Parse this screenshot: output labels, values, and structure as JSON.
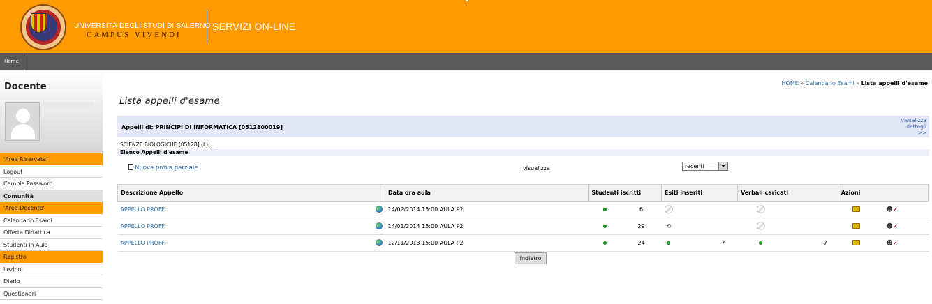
{
  "header": {
    "university_name": "UNIVERSITÀ DEGLI STUDI DI SALERNO",
    "motto": "CAMPUS VIVENDI",
    "service": "SERVIZI ON-LINE"
  },
  "navbar": {
    "home": "Home"
  },
  "sidebar": {
    "role": "Docente",
    "menu": [
      {
        "label": "'Area Riservata'",
        "kind": "header"
      },
      {
        "label": "Logout",
        "kind": "item"
      },
      {
        "label": "Cambia Password",
        "kind": "item"
      },
      {
        "label": "Comunità",
        "kind": "section"
      },
      {
        "label": "'Area Docente'",
        "kind": "header"
      },
      {
        "label": "Calendario Esami",
        "kind": "item"
      },
      {
        "label": "Offerta Didattica",
        "kind": "item"
      },
      {
        "label": "Studenti in Aula",
        "kind": "item"
      },
      {
        "label": "Registro",
        "kind": "header"
      },
      {
        "label": "Lezioni",
        "kind": "item"
      },
      {
        "label": "Diario",
        "kind": "item"
      },
      {
        "label": "Questionari",
        "kind": "item"
      }
    ]
  },
  "breadcrumb": {
    "home": "HOME",
    "sep": "»",
    "calendar": "Calendario Esami",
    "current": "Lista appelli d'esame"
  },
  "page_title": "Lista appelli d'esame",
  "course": {
    "label": "Appelli di: PRINCIPI DI INFORMATICA [0512800019]",
    "details_link": [
      "visualizza",
      "dettagli",
      ">>"
    ],
    "cds": "SCIENZE BIOLOGICHE [05128] (L)..."
  },
  "elenco": "Elenco Appelli d'esame",
  "new_prova": "Nuova prova parziale",
  "filter": {
    "label": "visualizza",
    "selected": "recenti"
  },
  "table": {
    "headers": [
      "Descrizione Appello",
      "Data ora aula",
      "Studenti iscritti",
      "Esiti inseriti",
      "Verbali caricati",
      "Azioni"
    ],
    "rows": [
      {
        "descr": "APPELLO PROFF.",
        "date": "14/02/2014 15:00 AULA P2",
        "iscritti": "6",
        "esiti": "none",
        "esiti_n": "",
        "verbali": "none",
        "verbali_n": ""
      },
      {
        "descr": "APPELLO PROFF.",
        "date": "14/01/2014 15:00 AULA P2",
        "iscritti": "29",
        "esiti": "refresh",
        "esiti_n": "",
        "verbali": "none",
        "verbali_n": ""
      },
      {
        "descr": "APPELLO PROFF.",
        "date": "12/11/2013 15:00 AULA P2",
        "iscritti": "24",
        "esiti": "dot",
        "esiti_n": "7",
        "verbali": "dot",
        "verbali_n": "7"
      }
    ]
  },
  "back_button": "Indietro",
  "colors": {
    "brand_orange": "#ff9a00",
    "nav_grey": "#5a5a5a",
    "link_blue": "#2b6cb0"
  }
}
